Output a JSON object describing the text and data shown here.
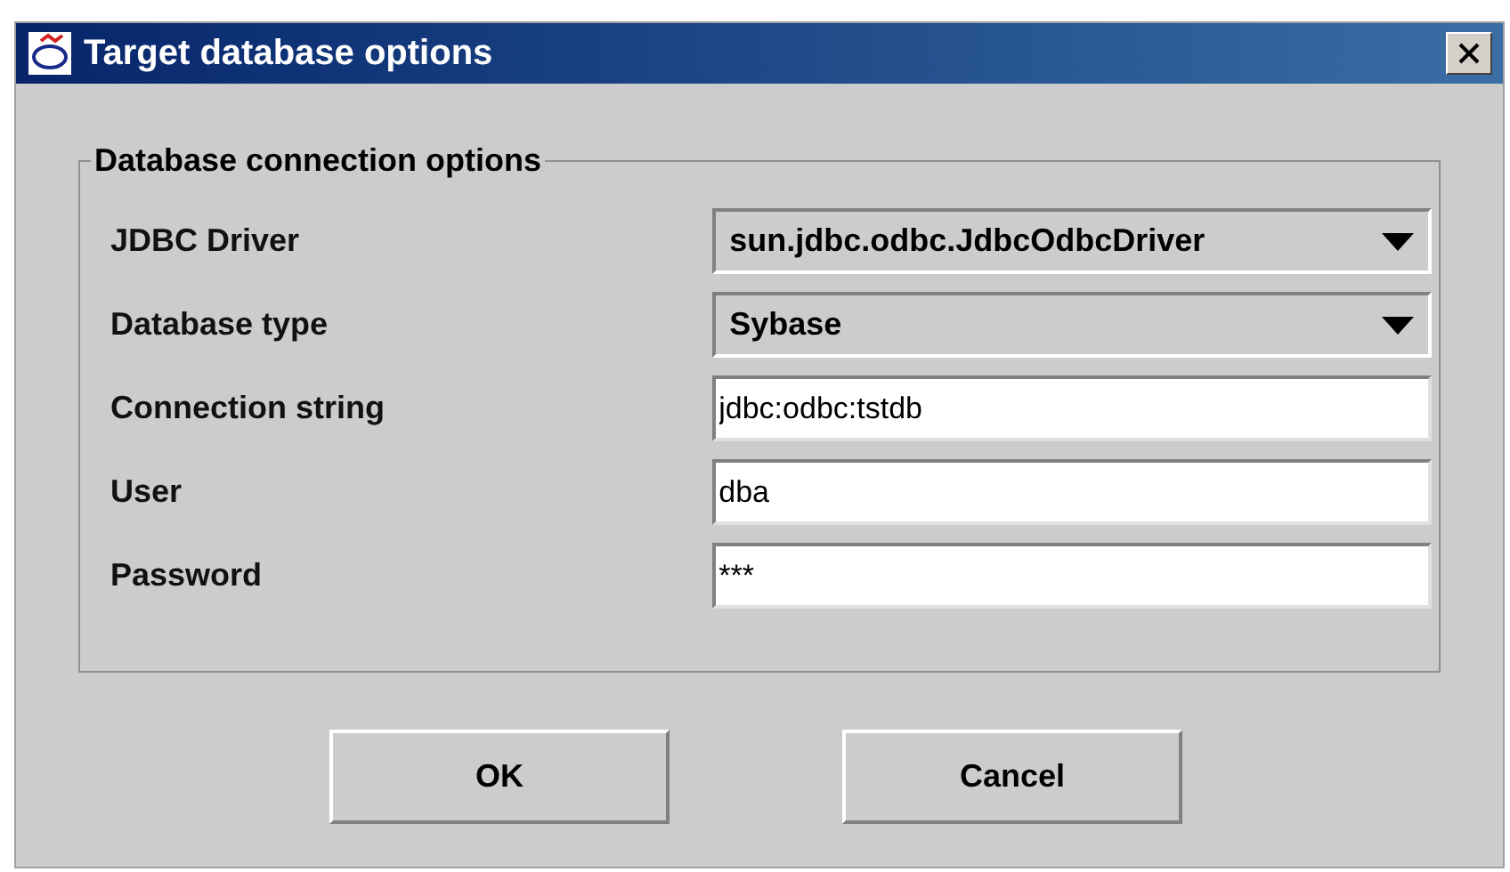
{
  "window": {
    "title": "Target database options"
  },
  "group": {
    "title": "Database connection options",
    "fields": [
      {
        "label": "JDBC Driver",
        "kind": "combo",
        "value": "sun.jdbc.odbc.JdbcOdbcDriver"
      },
      {
        "label": "Database type",
        "kind": "combo",
        "value": "Sybase"
      },
      {
        "label": "Connection string",
        "kind": "text",
        "value": "jdbc:odbc:tstdb"
      },
      {
        "label": "User",
        "kind": "text",
        "value": "dba"
      },
      {
        "label": "Password",
        "kind": "text",
        "value": "***"
      }
    ]
  },
  "buttons": [
    "OK",
    "Cancel"
  ]
}
